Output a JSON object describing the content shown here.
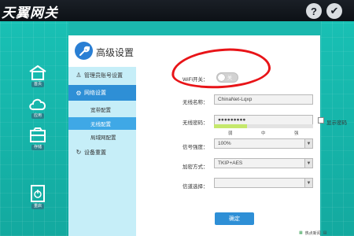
{
  "header": {
    "brand": "天翼网关",
    "help_icon": "?",
    "logout_icon": "✔"
  },
  "left_nav": {
    "items": [
      {
        "label": "首页",
        "icon": "home-icon"
      },
      {
        "label": "应用",
        "icon": "cloud-icon"
      },
      {
        "label": "存储",
        "icon": "storage-icon"
      },
      {
        "label": "重启",
        "icon": "power-icon"
      }
    ]
  },
  "panel": {
    "title": "高级设置",
    "menu": {
      "admin": "管理员账号设置",
      "network": "网络设置",
      "broadband": "宽带配置",
      "wireless": "无线配置",
      "lan": "局域网配置",
      "restore": "设备重置"
    }
  },
  "form": {
    "wifi_label": "WiFi开关：",
    "wifi_toggle_text": "关",
    "ssid_label": "无线名称：",
    "ssid_value": "ChinaNet-Lqxp",
    "password_label": "无线密码：",
    "password_value": "●●●●●●●●●",
    "show_password": "显示密码",
    "strength_weak": "弱",
    "strength_mid": "中",
    "strength_strong": "强",
    "signal_label": "信号强度：",
    "signal_value": "100%",
    "encrypt_label": "加密方式：",
    "encrypt_value": "TKIP+AES",
    "channel_label": "信道选择：",
    "channel_value": "",
    "confirm": "确定"
  },
  "statusbar": {
    "news": "热点新闻"
  },
  "colors": {
    "accent": "#2e8fd6",
    "teal": "#19c0b4",
    "highlight": "#e81418"
  }
}
